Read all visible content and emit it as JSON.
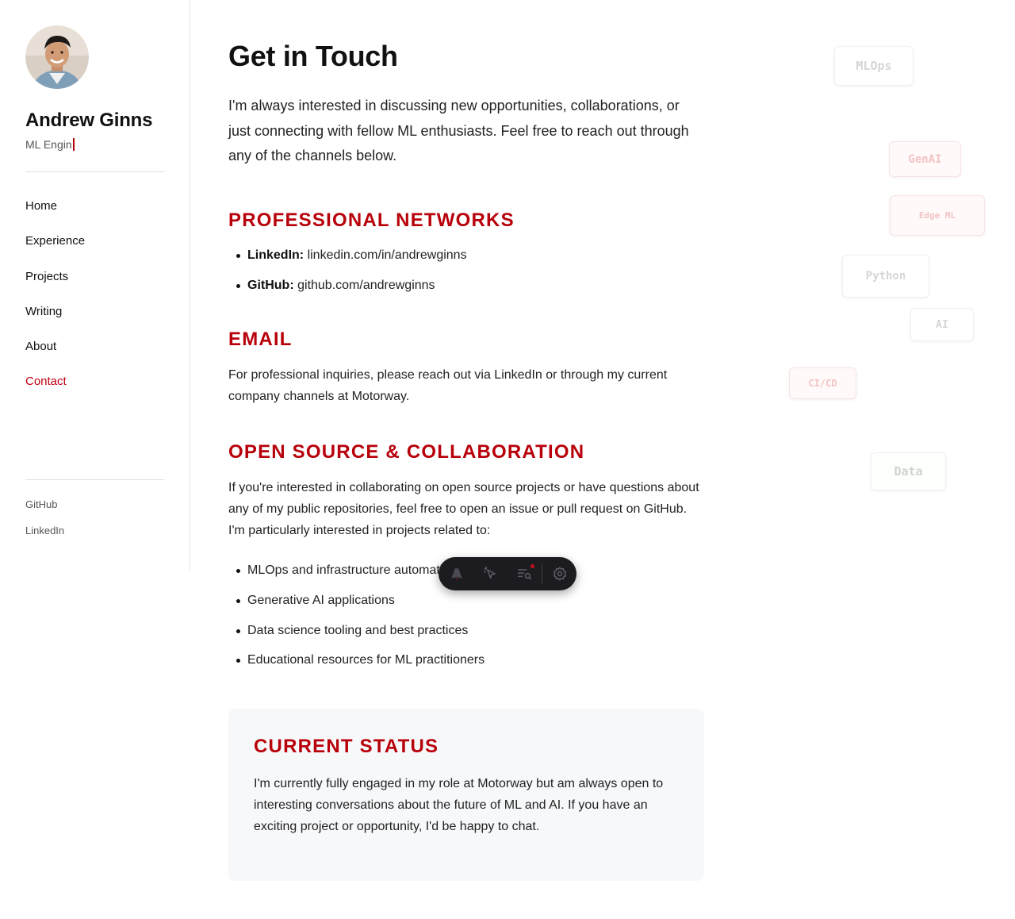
{
  "sidebar": {
    "name": "Andrew Ginns",
    "role_typed": "ML Engin",
    "nav": [
      {
        "label": "Home",
        "active": false
      },
      {
        "label": "Experience",
        "active": false
      },
      {
        "label": "Projects",
        "active": false
      },
      {
        "label": "Writing",
        "active": false
      },
      {
        "label": "About",
        "active": false
      },
      {
        "label": "Contact",
        "active": true
      }
    ],
    "social": [
      "GitHub",
      "LinkedIn"
    ]
  },
  "main": {
    "title": "Get in Touch",
    "intro": "I'm always interested in discussing new opportunities, collaborations, or just connecting with fellow ML enthusiasts. Feel free to reach out through any of the channels below.",
    "networks": {
      "heading": "PROFESSIONAL NETWORKS",
      "items": [
        {
          "label": "LinkedIn:",
          "value": "linkedin.com/in/andrewginns"
        },
        {
          "label": "GitHub:",
          "value": "github.com/andrewginns"
        }
      ]
    },
    "email": {
      "heading": "EMAIL",
      "text": "For professional inquiries, please reach out via LinkedIn or through my current company channels at Motorway."
    },
    "open_source": {
      "heading": "OPEN SOURCE & COLLABORATION",
      "text": "If you're interested in collaborating on open source projects or have questions about any of my public repositories, feel free to open an issue or pull request on GitHub. I'm particularly interested in projects related to:",
      "items": [
        "MLOps and infrastructure automation",
        "Generative AI applications",
        "Data science tooling and best practices",
        "Educational resources for ML practitioners"
      ]
    },
    "status": {
      "heading": "CURRENT STATUS",
      "text": "I'm currently fully engaged in my role at Motorway but am always open to interesting conversations about the future of ML and AI. If you have an exciting project or opportunity, I'd be happy to chat."
    }
  },
  "floating_tags": [
    "MLOps",
    "GenAI",
    "Edge ML",
    "Python",
    "AI",
    "CI/CD",
    "Data"
  ],
  "toolbar": {
    "icons": [
      "astro-logo-icon",
      "cursor-inspect-icon",
      "audit-list-icon",
      "settings-gear-icon"
    ]
  },
  "colors": {
    "accent": "#b8000a",
    "active_nav": "#c00010",
    "card_bg": "#f7f8fa",
    "toolbar_bg": "#1c1c20"
  }
}
